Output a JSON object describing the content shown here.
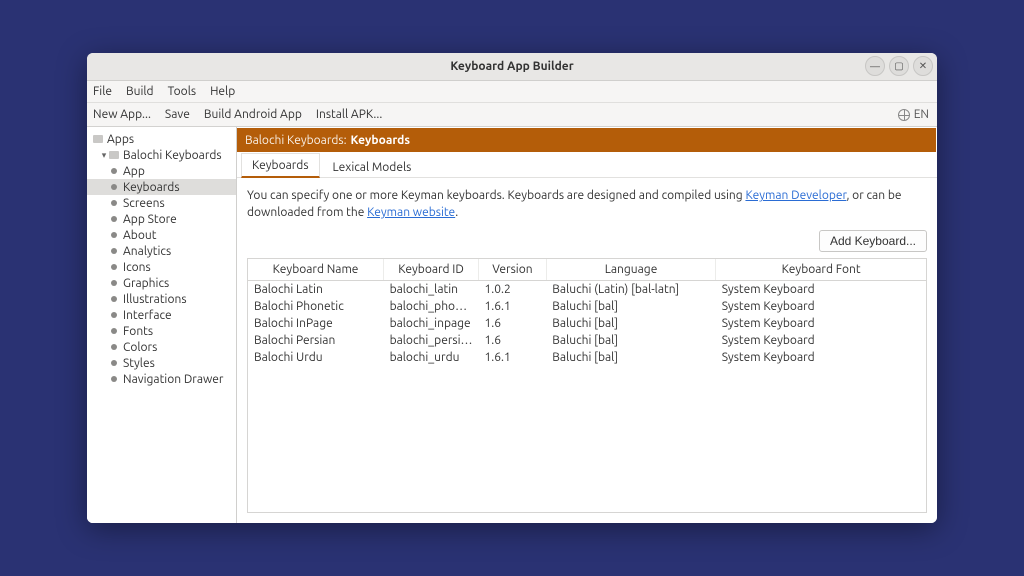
{
  "window": {
    "title": "Keyboard App Builder"
  },
  "menubar": {
    "file": "File",
    "build": "Build",
    "tools": "Tools",
    "help": "Help"
  },
  "toolbar": {
    "new_app": "New App...",
    "save": "Save",
    "build_android": "Build Android App",
    "install_apk": "Install APK...",
    "lang": "EN"
  },
  "sidebar": {
    "root": "Apps",
    "project": "Balochi Keyboards",
    "items": [
      "App",
      "Keyboards",
      "Screens",
      "App Store",
      "About",
      "Analytics",
      "Icons",
      "Graphics",
      "Illustrations",
      "Interface",
      "Fonts",
      "Colors",
      "Styles",
      "Navigation Drawer"
    ]
  },
  "header": {
    "crumb": "Balochi Keyboards:",
    "current": "Keyboards"
  },
  "tabs": {
    "keyboards": "Keyboards",
    "lexical": "Lexical Models"
  },
  "hint": {
    "part1": "You can specify one or more Keyman keyboards. Keyboards are designed and compiled using ",
    "link1": "Keyman Developer",
    "part2": ", or can be downloaded from the ",
    "link2": "Keyman website",
    "part3": "."
  },
  "buttons": {
    "add_keyboard": "Add Keyboard..."
  },
  "table": {
    "headers": {
      "name": "Keyboard Name",
      "id": "Keyboard ID",
      "version": "Version",
      "language": "Language",
      "font": "Keyboard Font"
    },
    "rows": [
      {
        "name": "Balochi Latin",
        "id": "balochi_latin",
        "version": "1.0.2",
        "language": "Baluchi (Latin) [bal-latn]",
        "font": "System Keyboard"
      },
      {
        "name": "Balochi Phonetic",
        "id": "balochi_phonetic",
        "version": "1.6.1",
        "language": "Baluchi [bal]",
        "font": "System Keyboard"
      },
      {
        "name": "Balochi InPage",
        "id": "balochi_inpage",
        "version": "1.6",
        "language": "Baluchi [bal]",
        "font": "System Keyboard"
      },
      {
        "name": "Balochi Persian",
        "id": "balochi_persian",
        "version": "1.6",
        "language": "Baluchi [bal]",
        "font": "System Keyboard"
      },
      {
        "name": "Balochi Urdu",
        "id": "balochi_urdu",
        "version": "1.6.1",
        "language": "Baluchi [bal]",
        "font": "System Keyboard"
      }
    ]
  }
}
